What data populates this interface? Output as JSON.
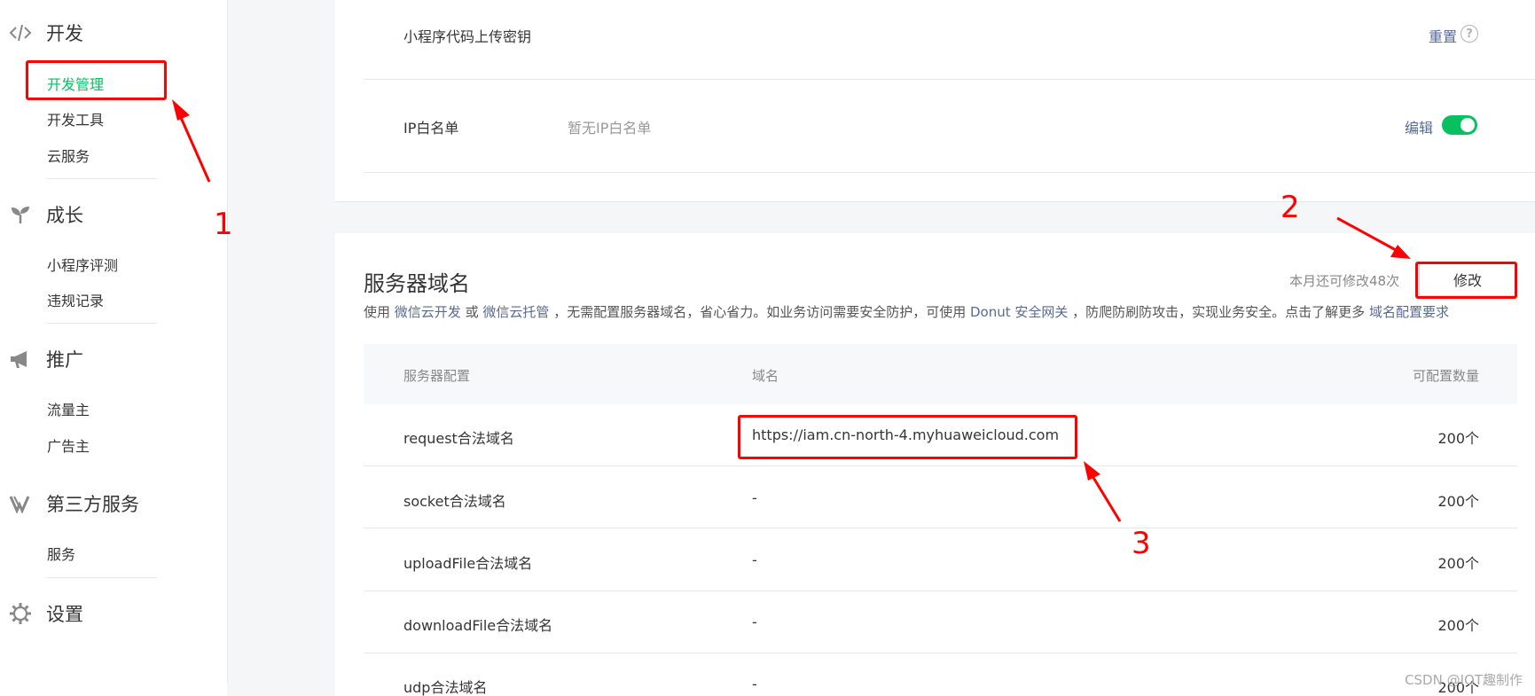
{
  "sidebar": {
    "sections": [
      {
        "title": "开发",
        "icon": "code-icon",
        "items": [
          "开发管理",
          "开发工具",
          "云服务"
        ]
      },
      {
        "title": "成长",
        "icon": "sprout-icon",
        "items": [
          "小程序评测",
          "违规记录"
        ]
      },
      {
        "title": "推广",
        "icon": "megaphone-icon",
        "items": [
          "流量主",
          "广告主"
        ]
      },
      {
        "title": "第三方服务",
        "icon": "third-party-icon",
        "items": [
          "服务"
        ]
      },
      {
        "title": "设置",
        "icon": "gear-icon",
        "items": []
      }
    ],
    "active_item": "开发管理"
  },
  "top_card": {
    "upload_key_label": "小程序代码上传密钥",
    "reset_link": "重置",
    "help_glyph": "?",
    "ip_whitelist_label": "IP白名单",
    "ip_whitelist_value": "暂无IP白名单",
    "edit_link": "编辑",
    "toggle_on": true
  },
  "server_domain": {
    "title": "服务器域名",
    "remaining_text": "本月还可修改48次",
    "modify_button": "修改",
    "desc": {
      "p1": "使用",
      "link1": "微信云开发",
      "p2": "或",
      "link2": "微信云托管",
      "p3": "，无需配置服务器域名，省心省力。如业务访问需要安全防护，可使用",
      "link3": "Donut 安全网关",
      "p4": "，防爬防刷防攻击，实现业务安全。点击了解更多",
      "link4": "域名配置要求"
    },
    "table": {
      "headers": [
        "服务器配置",
        "域名",
        "可配置数量"
      ],
      "rows": [
        {
          "name": "request合法域名",
          "domain": "https://iam.cn-north-4.myhuaweicloud.com",
          "count": "200个"
        },
        {
          "name": "socket合法域名",
          "domain": "-",
          "count": "200个"
        },
        {
          "name": "uploadFile合法域名",
          "domain": "-",
          "count": "200个"
        },
        {
          "name": "downloadFile合法域名",
          "domain": "-",
          "count": "200个"
        },
        {
          "name": "udp合法域名",
          "domain": "-",
          "count": "200个"
        }
      ]
    }
  },
  "annotations": {
    "n1": "1",
    "n2": "2",
    "n3": "3",
    "color": "#ff0000"
  },
  "watermark": "CSDN @IOT趣制作"
}
